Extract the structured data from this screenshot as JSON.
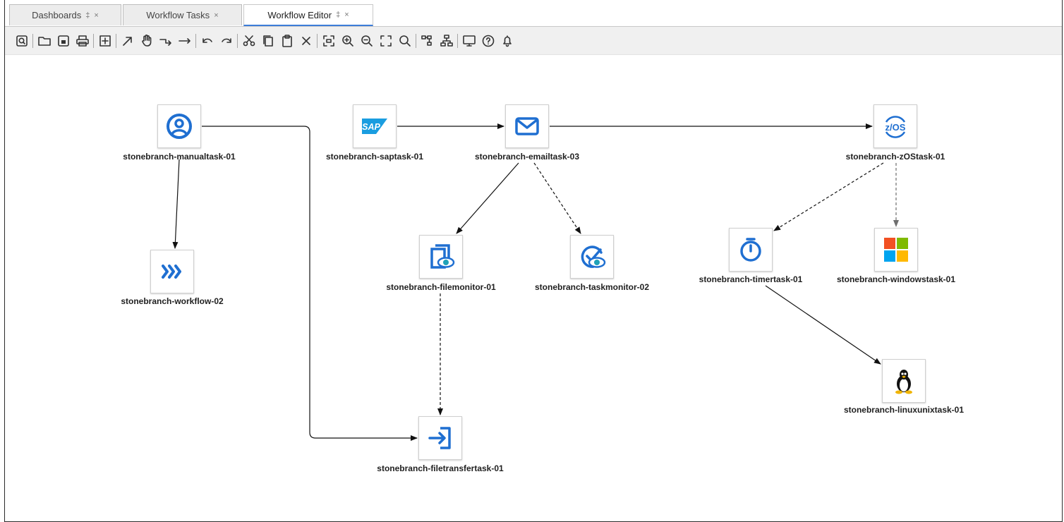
{
  "tabs": [
    {
      "label": "Dashboards",
      "pinned": true,
      "active": false
    },
    {
      "label": "Workflow Tasks",
      "pinned": false,
      "active": false
    },
    {
      "label": "Workflow Editor",
      "pinned": true,
      "active": true
    }
  ],
  "tab_glyphs": {
    "pin": "‡",
    "close": "×"
  },
  "toolbar": [
    "find-icon",
    "sep",
    "open-folder-icon",
    "save-icon",
    "print-icon",
    "sep",
    "expand-icon",
    "sep",
    "select-arrow-icon",
    "pan-hand-icon",
    "connector-elbow-icon",
    "connector-straight-icon",
    "sep",
    "undo-icon",
    "redo-icon",
    "sep",
    "cut-icon",
    "copy-icon",
    "paste-icon",
    "delete-icon",
    "sep",
    "fit-icon",
    "zoom-in-icon",
    "zoom-out-icon",
    "actual-size-icon",
    "search-icon",
    "sep",
    "layout-icon",
    "hierarchy-icon",
    "sep",
    "monitor-icon",
    "help-icon",
    "notification-bell-icon"
  ],
  "nodes": {
    "manualtask": {
      "label": "stonebranch-manualtask-01",
      "icon": "manual-task-icon"
    },
    "workflow": {
      "label": "stonebranch-workflow-02",
      "icon": "workflow-icon"
    },
    "saptask": {
      "label": "stonebranch-saptask-01",
      "icon": "sap-icon",
      "icon_text": "SAP"
    },
    "emailtask": {
      "label": "stonebranch-emailtask-03",
      "icon": "email-icon"
    },
    "filemonitor": {
      "label": "stonebranch-filemonitor-01",
      "icon": "file-monitor-icon"
    },
    "taskmonitor": {
      "label": "stonebranch-taskmonitor-02",
      "icon": "task-monitor-icon"
    },
    "filetransfer": {
      "label": "stonebranch-filetransfertask-01",
      "icon": "file-transfer-icon"
    },
    "zostask": {
      "label": "stonebranch-zOStask-01",
      "icon": "zos-icon",
      "icon_text": "z/OS"
    },
    "timertask": {
      "label": "stonebranch-timertask-01",
      "icon": "timer-icon"
    },
    "windowstask": {
      "label": "stonebranch-windowstask-01",
      "icon": "windows-icon"
    },
    "linuxtask": {
      "label": "stonebranch-linuxunixtask-01",
      "icon": "linux-icon"
    }
  },
  "edges": [
    {
      "from": "manualtask",
      "to": "workflow",
      "style": "solid"
    },
    {
      "from": "manualtask",
      "to": "filetransfer",
      "style": "solid"
    },
    {
      "from": "saptask",
      "to": "emailtask",
      "style": "solid"
    },
    {
      "from": "emailtask",
      "to": "zostask",
      "style": "solid"
    },
    {
      "from": "emailtask",
      "to": "filemonitor",
      "style": "solid"
    },
    {
      "from": "emailtask",
      "to": "taskmonitor",
      "style": "dashed"
    },
    {
      "from": "filemonitor",
      "to": "filetransfer",
      "style": "dashed"
    },
    {
      "from": "zostask",
      "to": "timertask",
      "style": "dashed"
    },
    {
      "from": "zostask",
      "to": "windowstask",
      "style": "dashed"
    },
    {
      "from": "timertask",
      "to": "linuxtask",
      "style": "solid"
    }
  ],
  "colors": {
    "accent": "#1f6fd1",
    "sap_blue": "#1a9de0",
    "edge": "#111111",
    "dashed_gray": "#6e6e6e"
  }
}
